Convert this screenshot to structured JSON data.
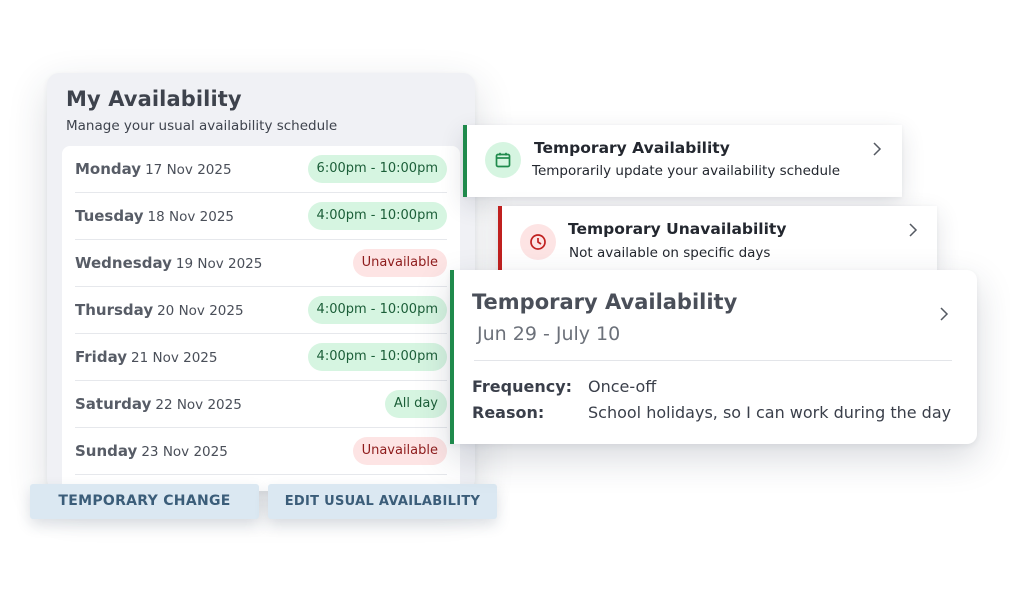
{
  "availability": {
    "title": "My Availability",
    "subtitle": "Manage your usual availability schedule",
    "days": [
      {
        "day": "Monday",
        "date": "17 Nov 2025",
        "status": "6:00pm - 10:00pm",
        "available": true
      },
      {
        "day": "Tuesday",
        "date": "18 Nov 2025",
        "status": "4:00pm - 10:00pm",
        "available": true
      },
      {
        "day": "Wednesday",
        "date": "19 Nov 2025",
        "status": "Unavailable",
        "available": false
      },
      {
        "day": "Thursday",
        "date": "20 Nov 2025",
        "status": "4:00pm - 10:00pm",
        "available": true
      },
      {
        "day": "Friday",
        "date": "21 Nov 2025",
        "status": "4:00pm - 10:00pm",
        "available": true
      },
      {
        "day": "Saturday",
        "date": "22 Nov 2025",
        "status": "All day",
        "available": true
      },
      {
        "day": "Sunday",
        "date": "23 Nov 2025",
        "status": "Unavailable",
        "available": false
      }
    ]
  },
  "buttons": {
    "temporary_change": "TEMPORARY CHANGE",
    "edit_usual": "EDIT USUAL AVAILABILITY"
  },
  "options": {
    "temporary_availability": {
      "title": "Temporary Availability",
      "description": "Temporarily update your availability schedule",
      "icon": "calendar-icon",
      "accent": "#1f8a4c"
    },
    "temporary_unavailability": {
      "title": "Temporary Unavailability",
      "description": "Not available on specific days",
      "icon": "clock-icon",
      "accent": "#c0201f"
    }
  },
  "detail": {
    "title": "Temporary Availability",
    "dates": "Jun 29 - July 10",
    "frequency_label": "Frequency:",
    "frequency_value": "Once-off",
    "reason_label": "Reason:",
    "reason_value": "School holidays, so I can work during the day"
  },
  "colors": {
    "available_bg": "#d6f5e1",
    "available_text": "#1b5e38",
    "unavailable_bg": "#fde4e4",
    "unavailable_text": "#8e1c1c",
    "button_bg": "#dbe8f2",
    "button_text": "#3b5d79"
  }
}
